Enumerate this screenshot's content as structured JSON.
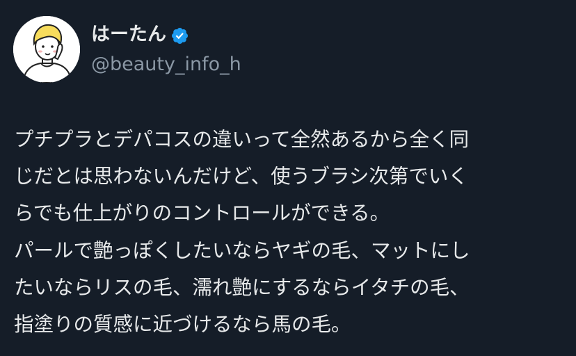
{
  "user": {
    "display_name": "はーたん",
    "handle": "@beauty_info_h",
    "verified": true,
    "verified_color": "#1d9bf0",
    "avatar_icon": "cartoon-person-avatar"
  },
  "tweet": {
    "lines": [
      "プチプラとデパコスの違いって全然あるから全く同",
      "じだとは思わないんだけど、使うブラシ次第でいく",
      "らでも仕上がりのコントロールができる。",
      "パールで艶っぽくしたいならヤギの毛、マットにし",
      "たいならリスの毛、濡れ艶にするならイタチの毛、",
      "指塗りの質感に近づけるなら馬の毛。"
    ]
  },
  "colors": {
    "background": "#151d28",
    "text_primary": "#e7e9ea",
    "text_secondary": "#8b98a5"
  }
}
